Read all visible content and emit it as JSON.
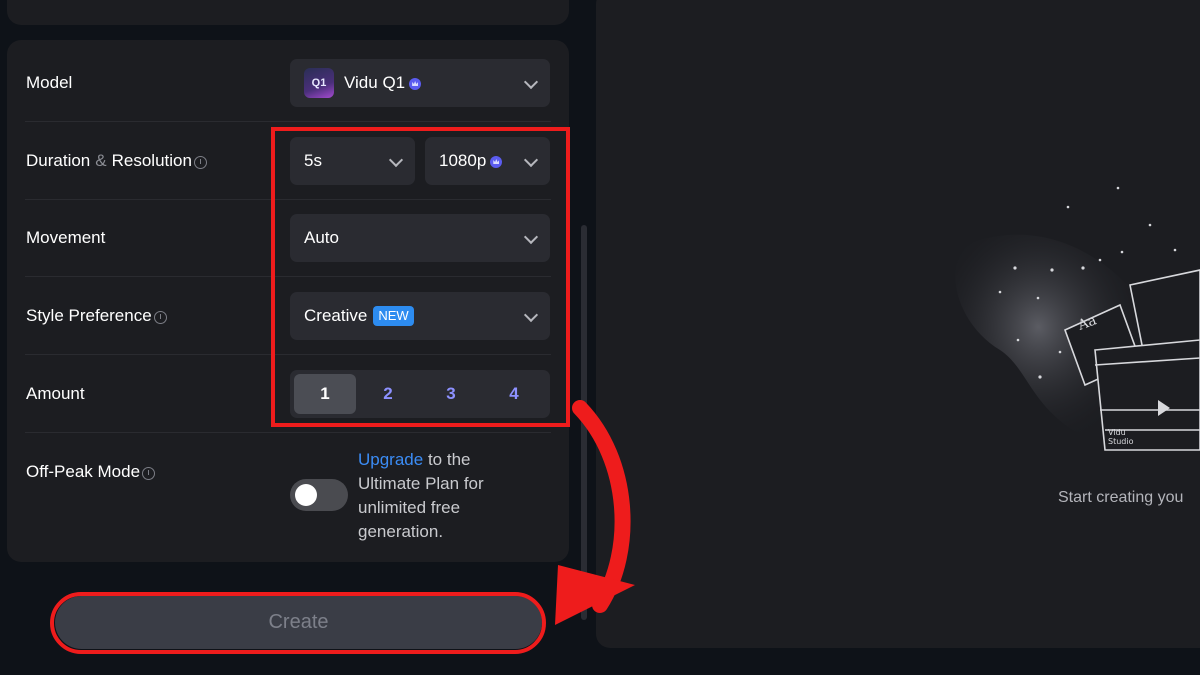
{
  "settings": {
    "model": {
      "label": "Model",
      "value": "Vidu Q1",
      "thumb_text": "Q1"
    },
    "duration_resolution": {
      "label_part1": "Duration",
      "label_amp": "&",
      "label_part2": "Resolution",
      "duration_value": "5s",
      "resolution_value": "1080p"
    },
    "movement": {
      "label": "Movement",
      "value": "Auto"
    },
    "style_preference": {
      "label": "Style Preference",
      "value": "Creative",
      "badge": "NEW"
    },
    "amount": {
      "label": "Amount",
      "options": [
        "1",
        "2",
        "3",
        "4"
      ],
      "selected": "1"
    },
    "off_peak": {
      "label": "Off-Peak Mode",
      "enabled": false,
      "upgrade_link": "Upgrade",
      "upgrade_rest": " to the Ultimate Plan for unlimited free generation."
    }
  },
  "create_button": {
    "label": "Create"
  },
  "preview": {
    "empty_text": "Start creating you",
    "art_caption_line1": "Vidu",
    "art_caption_line2": "Studio",
    "art_letters": "Aa"
  },
  "colors": {
    "accent": "#8d91ff",
    "link": "#3b8cf5",
    "badge": "#2d8cf0",
    "annotation": "#ee1c1c"
  }
}
